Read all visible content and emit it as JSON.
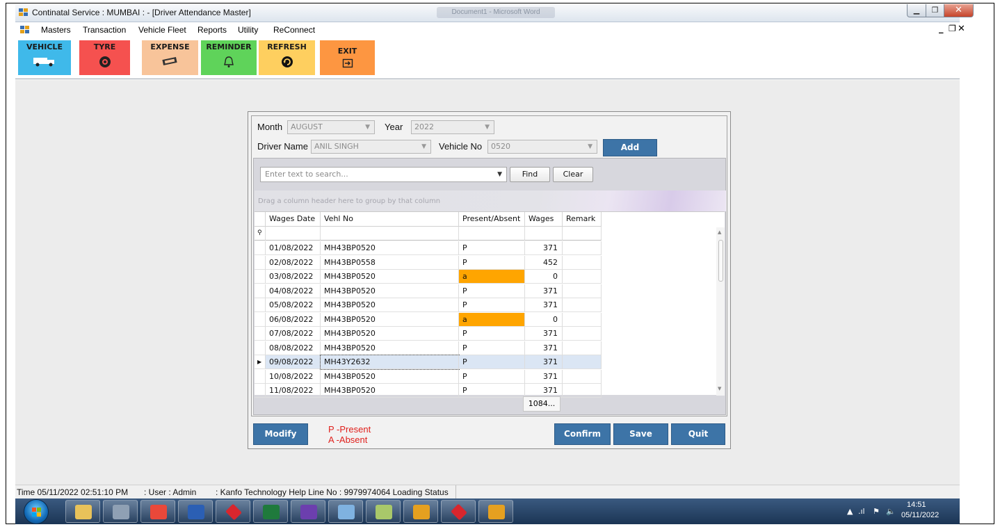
{
  "window": {
    "title": "Continatal Service : MUMBAI : - [Driver Attendance Master]",
    "background_app": "Document1 - Microsoft Word"
  },
  "menu": {
    "items": [
      "Masters",
      "Transaction",
      "Vehicle Fleet",
      "Reports",
      "Utility",
      "ReConnect"
    ],
    "mdi_controls": {
      "minimize": "_",
      "restore": "❐",
      "close": "✕"
    }
  },
  "toolbar": {
    "buttons": [
      {
        "label": "VEHICLE",
        "icon": "truck-icon",
        "color": "#3fb9ea"
      },
      {
        "label": "TYRE",
        "icon": "tyre-icon",
        "color": "#f5514f"
      },
      {
        "label": "EXPENSE",
        "icon": "money-icon",
        "color": "#f8c49a"
      },
      {
        "label": "REMINDER",
        "icon": "bell-icon",
        "color": "#5fd35a"
      },
      {
        "label": "REFRESH",
        "icon": "refresh-icon",
        "color": "#fecf5f"
      },
      {
        "label": "EXIT",
        "icon": "exit-icon",
        "color": "#fd9641"
      }
    ]
  },
  "form": {
    "month_label": "Month",
    "month_value": "AUGUST",
    "year_label": "Year",
    "year_value": "2022",
    "driver_label": "Driver Name",
    "driver_value": "ANIL SINGH",
    "vehicle_label": "Vehicle No",
    "vehicle_value": "0520",
    "add_label": "Add",
    "search_placeholder": "Enter text to search...",
    "find_label": "Find",
    "clear_label": "Clear",
    "group_hint": "Drag a column header here to group by that column",
    "legend_present": "P -Present",
    "legend_absent": "A -Absent",
    "modify_label": "Modify",
    "confirm_label": "Confirm",
    "save_label": "Save",
    "quit_label": "Quit"
  },
  "grid": {
    "columns": [
      "Wages Date",
      "Vehl No",
      "Present/Absent",
      "Wages",
      "Remark"
    ],
    "rows": [
      {
        "date": "01/08/2022",
        "vehl": "MH43BP0520",
        "status": "P",
        "wages": "371",
        "remark": ""
      },
      {
        "date": "02/08/2022",
        "vehl": "MH43BP0558",
        "status": "P",
        "wages": "452",
        "remark": ""
      },
      {
        "date": "03/08/2022",
        "vehl": "MH43BP0520",
        "status": "a",
        "wages": "0",
        "remark": ""
      },
      {
        "date": "04/08/2022",
        "vehl": "MH43BP0520",
        "status": "P",
        "wages": "371",
        "remark": ""
      },
      {
        "date": "05/08/2022",
        "vehl": "MH43BP0520",
        "status": "P",
        "wages": "371",
        "remark": ""
      },
      {
        "date": "06/08/2022",
        "vehl": "MH43BP0520",
        "status": "a",
        "wages": "0",
        "remark": ""
      },
      {
        "date": "07/08/2022",
        "vehl": "MH43BP0520",
        "status": "P",
        "wages": "371",
        "remark": ""
      },
      {
        "date": "08/08/2022",
        "vehl": "MH43BP0520",
        "status": "P",
        "wages": "371",
        "remark": ""
      },
      {
        "date": "09/08/2022",
        "vehl": "MH43Y2632",
        "status": "P",
        "wages": "371",
        "remark": ""
      },
      {
        "date": "10/08/2022",
        "vehl": "MH43BP0520",
        "status": "P",
        "wages": "371",
        "remark": ""
      },
      {
        "date": "11/08/2022",
        "vehl": "MH43BP0520",
        "status": "P",
        "wages": "371",
        "remark": ""
      }
    ],
    "selected_row": 8,
    "wages_total": "1084...",
    "absent_color": "#ffa500",
    "selected_color": "#dbe6f4"
  },
  "status": {
    "time": "Time  05/11/2022 02:51:10 PM",
    "user": ": User : Admin",
    "help": ": Kanfo Technology Help Line No : 9979974064  Loading Status"
  },
  "tray": {
    "time": "14:51",
    "date": "05/11/2022"
  },
  "taskbar": {
    "apps": [
      "explorer-icon",
      "tools-icon",
      "chrome-icon",
      "word-icon",
      "red-diamond-icon",
      "excel-icon",
      "visual-studio-icon",
      "notes-icon",
      "notepad-icon",
      "app-window-icon",
      "red-diamond-icon",
      "app-window-icon"
    ]
  }
}
